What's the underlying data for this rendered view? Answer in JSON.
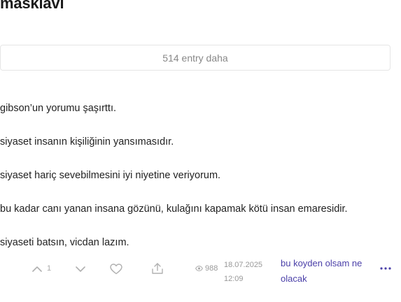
{
  "topic": {
    "title": "masklavi"
  },
  "more_entries": {
    "label": "514 entry daha"
  },
  "entry": {
    "paragraphs": [
      "gibson’un yorumu şaşırttı.",
      "siyaset insanın kişiliğinin yansımasıdır.",
      "siyaset hariç sevebilmesini iyi niyetine veriyorum.",
      "bu kadar canı yanan insana gözünü, kulağını kapamak kötü insan emaresidir.",
      "siyaseti batsın, vicdan lazım."
    ],
    "upvotes": "1",
    "views": "988",
    "date": "18.07.2025",
    "time": "12:09",
    "author": "bu koyden olsam ne olacak"
  },
  "icons": {
    "upvote": "chevron-up-icon",
    "downvote": "chevron-down-icon",
    "favorite": "heart-icon",
    "share": "share-icon",
    "views": "eye-icon",
    "more": "more-dots-icon"
  },
  "colors": {
    "author": "#4a3fa8",
    "more_dots": "#4a3fa8",
    "muted": "#999999",
    "icon": "#b0b0b0"
  }
}
